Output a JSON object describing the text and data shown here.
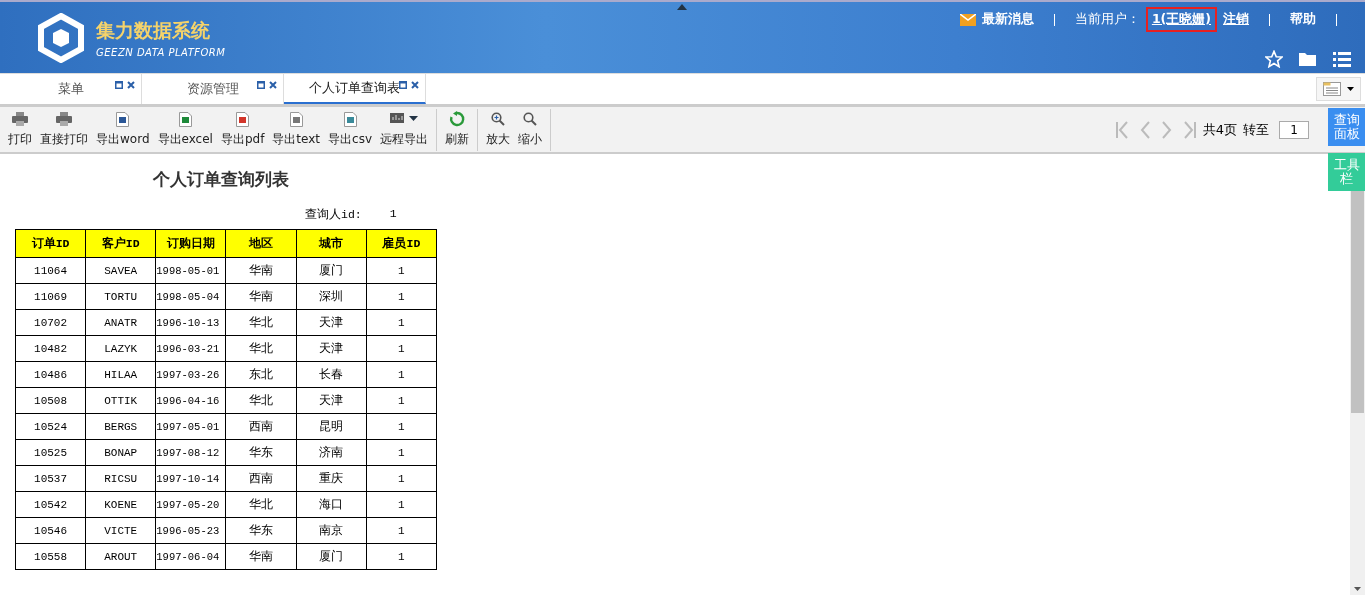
{
  "header": {
    "title": "集力数据系统",
    "subtitle": "GEEZN DATA PLATFORM",
    "messages": "最新消息",
    "user_label": "当前用户：",
    "user": "1(王晓姗)",
    "user_highlighted": true,
    "logout": "注销",
    "help": "帮助"
  },
  "tabs": [
    {
      "label": "菜单",
      "selected": false
    },
    {
      "label": "资源管理",
      "selected": false
    },
    {
      "label": "个人订单查询表",
      "selected": true
    }
  ],
  "toolbar": [
    {
      "kind": "print",
      "label": "打印"
    },
    {
      "kind": "print",
      "label": "直接打印"
    },
    {
      "kind": "word",
      "label": "导出word"
    },
    {
      "kind": "excel",
      "label": "导出excel"
    },
    {
      "kind": "pdf",
      "label": "导出pdf"
    },
    {
      "kind": "text",
      "label": "导出text"
    },
    {
      "kind": "csv",
      "label": "导出csv"
    },
    {
      "kind": "remote",
      "label": "远程导出"
    },
    {
      "kind": "refresh",
      "label": "刷新"
    },
    {
      "kind": "zoomin",
      "label": "放大"
    },
    {
      "kind": "zoomout",
      "label": "缩小"
    }
  ],
  "pager": {
    "total": "共4页",
    "goto": "转至",
    "page": "1"
  },
  "side_buttons": [
    {
      "kind": "query",
      "label": "查询面板"
    },
    {
      "kind": "tools",
      "label": "工具栏"
    }
  ],
  "report": {
    "title": "个人订单查询列表",
    "param_label": "查询人id:",
    "param_value": "1",
    "columns": [
      "订单ID",
      "客户ID",
      "订购日期",
      "地区",
      "城市",
      "雇员ID"
    ],
    "rows": [
      [
        "11064",
        "SAVEA",
        "1998-05-01",
        "华南",
        "厦门",
        "1"
      ],
      [
        "11069",
        "TORTU",
        "1998-05-04",
        "华南",
        "深圳",
        "1"
      ],
      [
        "10702",
        "ANATR",
        "1996-10-13",
        "华北",
        "天津",
        "1"
      ],
      [
        "10482",
        "LAZYK",
        "1996-03-21",
        "华北",
        "天津",
        "1"
      ],
      [
        "10486",
        "HILAA",
        "1997-03-26",
        "东北",
        "长春",
        "1"
      ],
      [
        "10508",
        "OTTIK",
        "1996-04-16",
        "华北",
        "天津",
        "1"
      ],
      [
        "10524",
        "BERGS",
        "1997-05-01",
        "西南",
        "昆明",
        "1"
      ],
      [
        "10525",
        "BONAP",
        "1997-08-12",
        "华东",
        "济南",
        "1"
      ],
      [
        "10537",
        "RICSU",
        "1997-10-14",
        "西南",
        "重庆",
        "1"
      ],
      [
        "10542",
        "KOENE",
        "1997-05-20",
        "华北",
        "海口",
        "1"
      ],
      [
        "10546",
        "VICTE",
        "1996-05-23",
        "华东",
        "南京",
        "1"
      ],
      [
        "10558",
        "AROUT",
        "1997-06-04",
        "华南",
        "厦门",
        "1"
      ]
    ]
  }
}
